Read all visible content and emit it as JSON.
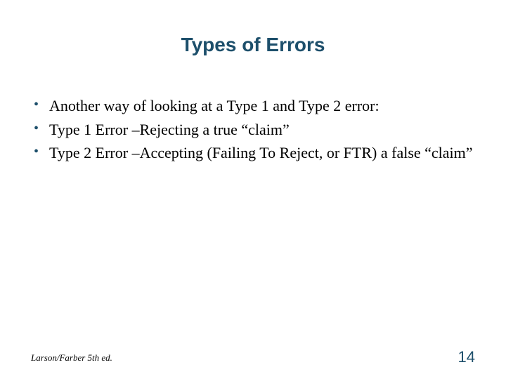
{
  "title": "Types of Errors",
  "bullets": [
    "Another way of looking at a Type 1 and Type 2 error:",
    "Type 1 Error –Rejecting a true “claim”",
    "Type 2 Error –Accepting (Failing To Reject, or FTR) a false “claim”"
  ],
  "footer_source": "Larson/Farber 5th ed.",
  "page_number": "14"
}
